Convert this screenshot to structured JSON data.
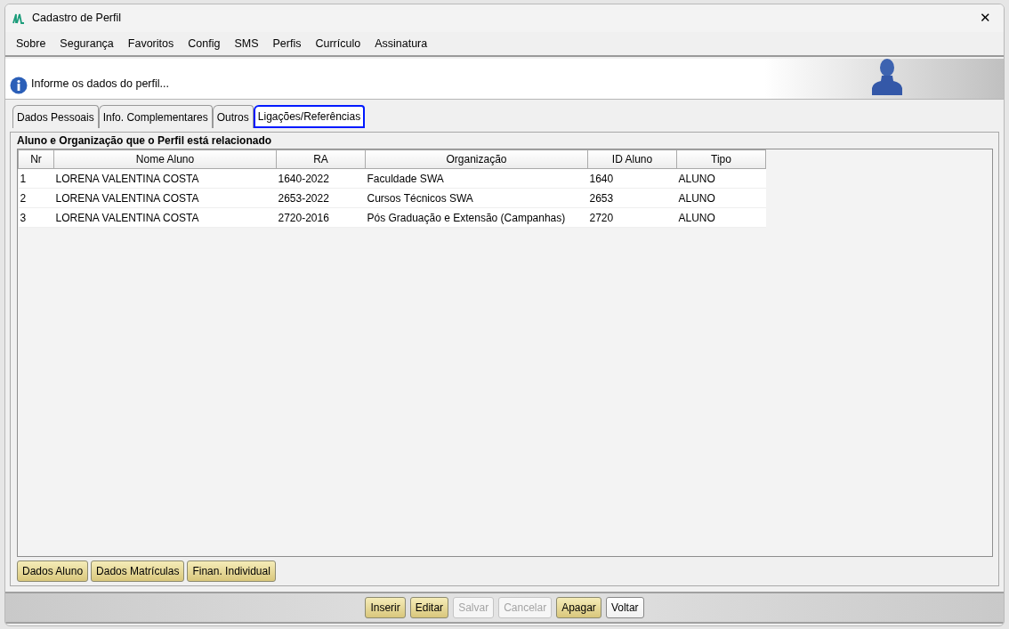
{
  "window": {
    "title": "Cadastro de Perfil",
    "close": "✕"
  },
  "menu": [
    "Sobre",
    "Segurança",
    "Favoritos",
    "Config",
    "SMS",
    "Perfis",
    "Currículo",
    "Assinatura"
  ],
  "header": {
    "message": "Informe os dados do perfil..."
  },
  "tabs": [
    {
      "label": "Dados Pessoais",
      "selected": false
    },
    {
      "label": "Info. Complementares",
      "selected": false
    },
    {
      "label": "Outros",
      "selected": false
    },
    {
      "label": "Ligações/Referências",
      "selected": true
    }
  ],
  "group": {
    "title": "Aluno e Organização que o Perfil está relacionado"
  },
  "table": {
    "columns": [
      "Nr",
      "Nome Aluno",
      "RA",
      "Organização",
      "ID Aluno",
      "Tipo"
    ],
    "rows": [
      [
        "1",
        "LORENA VALENTINA COSTA",
        "1640-2022",
        "Faculdade SWA",
        "1640",
        "ALUNO"
      ],
      [
        "2",
        "LORENA VALENTINA COSTA",
        "2653-2022",
        "Cursos Técnicos SWA",
        "2653",
        "ALUNO"
      ],
      [
        "3",
        "LORENA VALENTINA COSTA",
        "2720-2016",
        "Pós Graduação e Extensão (Campanhas)",
        "2720",
        "ALUNO"
      ]
    ]
  },
  "group_buttons": [
    {
      "label": "Dados Aluno",
      "disabled": false
    },
    {
      "label": "Dados Matrículas",
      "disabled": false
    },
    {
      "label": "Finan. Individual",
      "disabled": false
    }
  ],
  "footer_buttons": [
    {
      "label": "Inserir",
      "kind": "action",
      "disabled": false
    },
    {
      "label": "Editar",
      "kind": "action",
      "disabled": false
    },
    {
      "label": "Salvar",
      "kind": "action",
      "disabled": true
    },
    {
      "label": "Cancelar",
      "kind": "action",
      "disabled": true
    },
    {
      "label": "Apagar",
      "kind": "action",
      "disabled": false
    },
    {
      "label": "Voltar",
      "kind": "plain",
      "disabled": false
    }
  ]
}
